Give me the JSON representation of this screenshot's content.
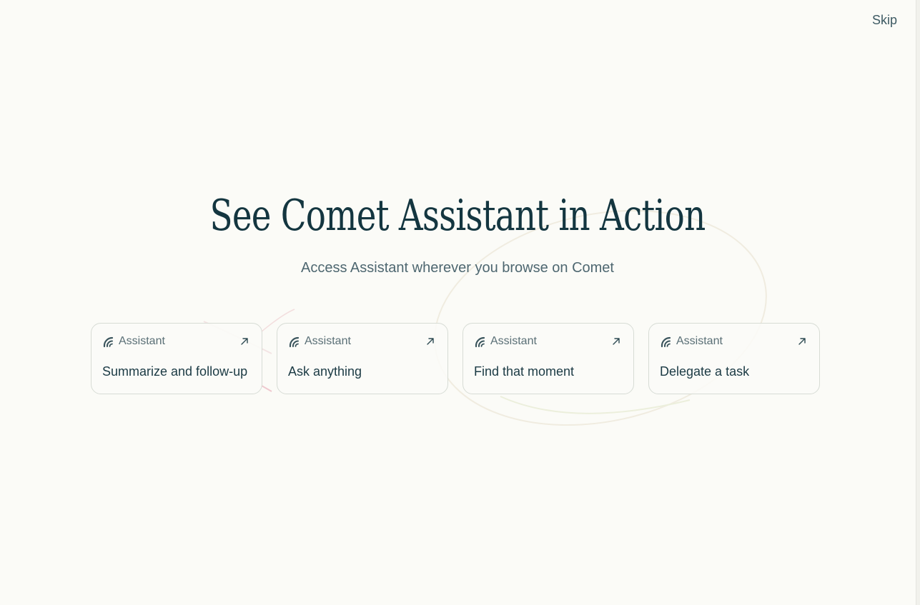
{
  "header": {
    "skip_label": "Skip"
  },
  "hero": {
    "title": "See Comet Assistant in Action",
    "subtitle": "Access Assistant wherever you browse on Comet"
  },
  "cards": [
    {
      "label": "Assistant",
      "title": "Summarize and follow-up"
    },
    {
      "label": "Assistant",
      "title": "Ask anything"
    },
    {
      "label": "Assistant",
      "title": "Find that moment"
    },
    {
      "label": "Assistant",
      "title": "Delegate a task"
    }
  ],
  "colors": {
    "background": "#fbfbf7",
    "heading": "#143640",
    "body_text": "#4e6770",
    "card_border": "#d7dcd5"
  },
  "icons": {
    "card_logo": "assistant-logo-icon",
    "card_action": "arrow-up-right-icon"
  }
}
